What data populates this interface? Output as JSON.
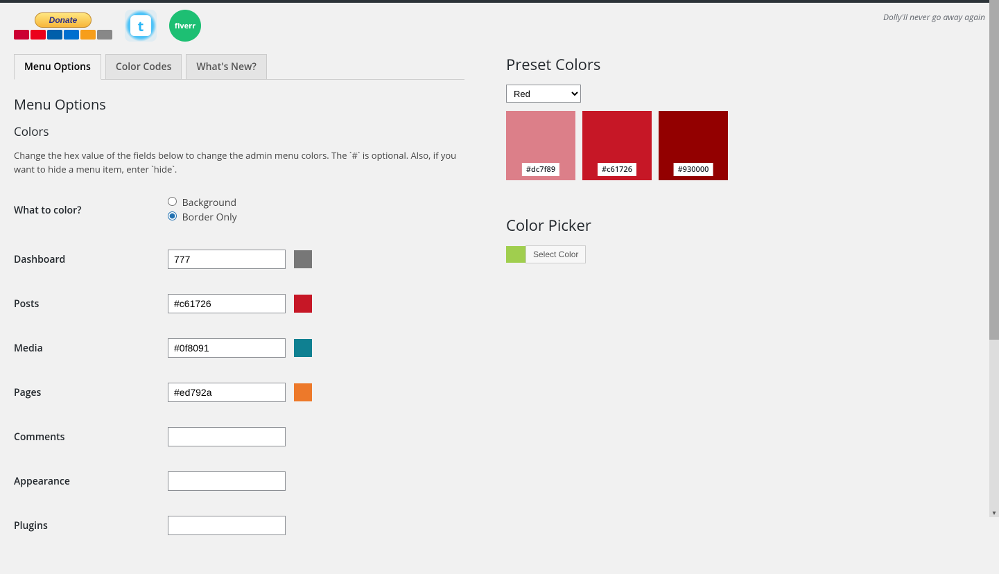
{
  "dolly_text": "Dolly'll never go away again",
  "donate_label": "Donate",
  "fiverr_label": "fiverr",
  "tabs": [
    "Menu Options",
    "Color Codes",
    "What's New?"
  ],
  "active_tab": 0,
  "section_title": "Menu Options",
  "subsection_title": "Colors",
  "description": "Change the hex value of the fields below to change the admin menu colors. The `#` is optional. Also, if you want to hide a menu item, enter `hide`.",
  "what_to_color_label": "What to color?",
  "radio_options": {
    "background": "Background",
    "border": "Border Only"
  },
  "radio_selected": "border",
  "menu_items": [
    {
      "label": "Dashboard",
      "value": "777",
      "swatch": "#777777"
    },
    {
      "label": "Posts",
      "value": "#c61726",
      "swatch": "#c61726"
    },
    {
      "label": "Media",
      "value": "#0f8091",
      "swatch": "#0f8091"
    },
    {
      "label": "Pages",
      "value": "#ed792a",
      "swatch": "#ed792a"
    },
    {
      "label": "Comments",
      "value": "",
      "swatch": ""
    },
    {
      "label": "Appearance",
      "value": "",
      "swatch": ""
    },
    {
      "label": "Plugins",
      "value": "",
      "swatch": ""
    }
  ],
  "preset_colors_title": "Preset Colors",
  "preset_selected": "Red",
  "preset_swatches": [
    {
      "hex": "#dc7f89"
    },
    {
      "hex": "#c61726"
    },
    {
      "hex": "#930000"
    }
  ],
  "color_picker_title": "Color Picker",
  "color_picker_button": "Select Color",
  "color_picker_value": "#a0ce4e",
  "card_colors": [
    "#c03",
    "#eb001b",
    "#005faa",
    "#006fcf",
    "#f79e1b",
    "#888"
  ]
}
